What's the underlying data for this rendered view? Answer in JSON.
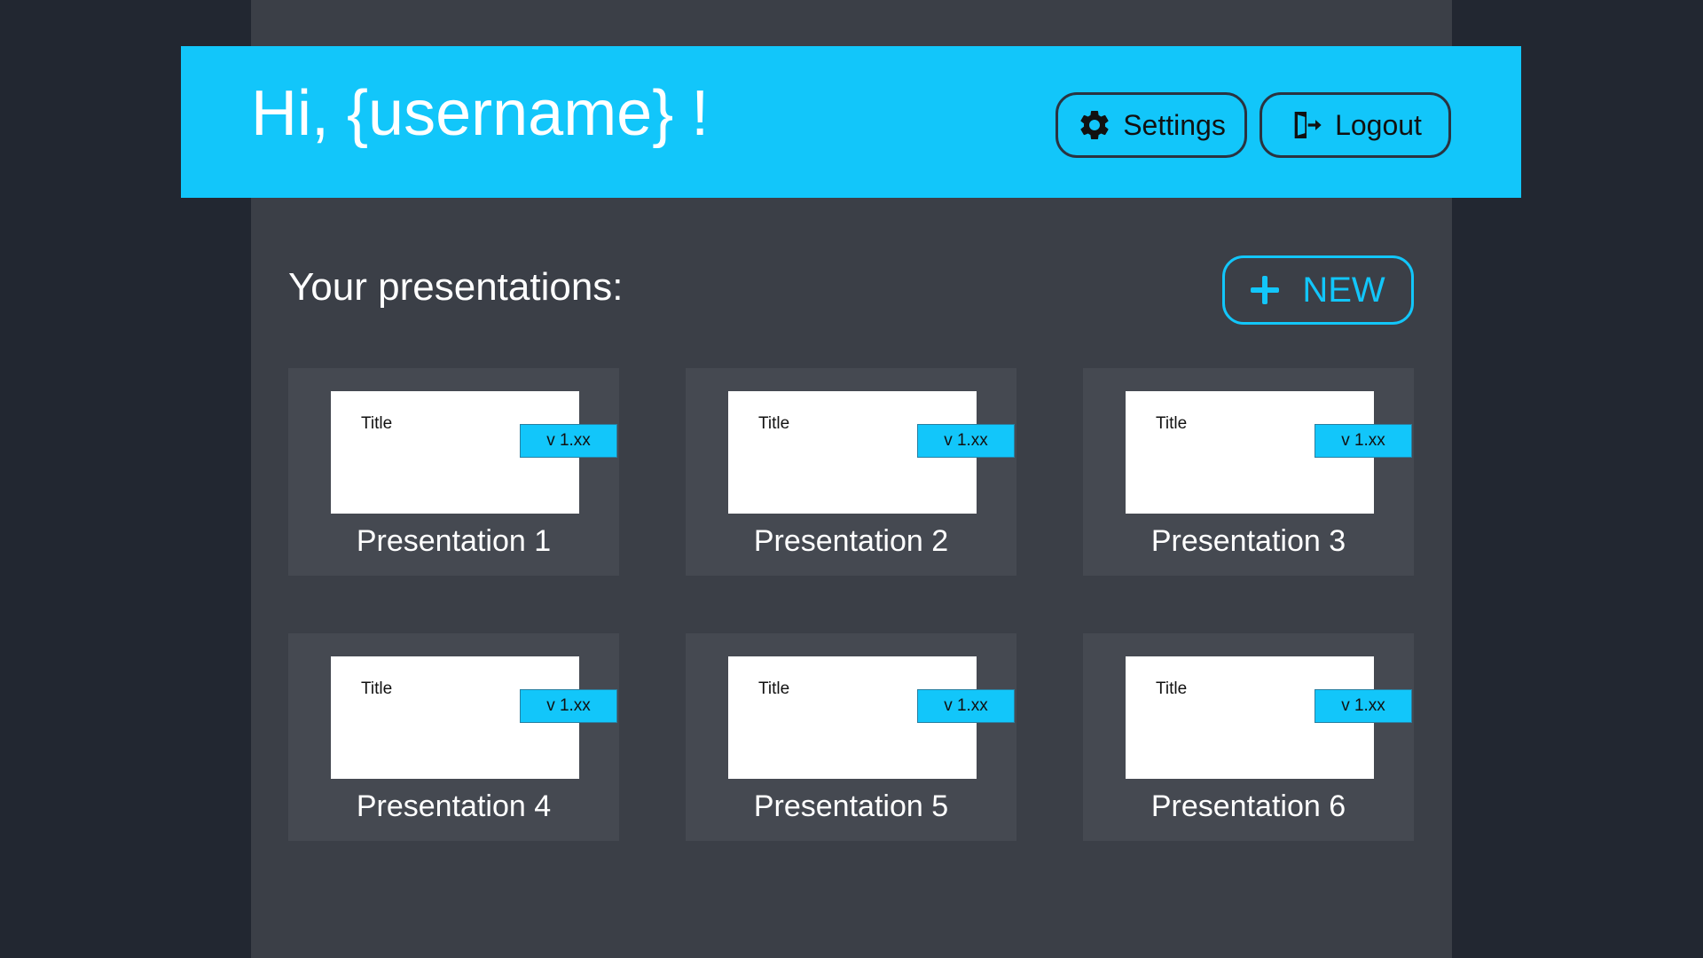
{
  "header": {
    "greeting": "Hi, {username} !",
    "settings_label": "Settings",
    "settings_icon": "gear-icon",
    "logout_label": "Logout",
    "logout_icon": "logout-door-icon"
  },
  "main": {
    "section_title": "Your presentations:",
    "new_button_label": "NEW",
    "new_button_icon": "plus-icon"
  },
  "presentations": [
    {
      "name": "Presentation 1",
      "thumb_title": "Title",
      "version": "v 1.xx"
    },
    {
      "name": "Presentation 2",
      "thumb_title": "Title",
      "version": "v 1.xx"
    },
    {
      "name": "Presentation 3",
      "thumb_title": "Title",
      "version": "v 1.xx"
    },
    {
      "name": "Presentation 4",
      "thumb_title": "Title",
      "version": "v 1.xx"
    },
    {
      "name": "Presentation 5",
      "thumb_title": "Title",
      "version": "v 1.xx"
    },
    {
      "name": "Presentation 6",
      "thumb_title": "Title",
      "version": "v 1.xx"
    }
  ],
  "colors": {
    "accent": "#12c6fa",
    "page_background": "#222731",
    "panel_background": "#3b3f47",
    "card_background": "#454951"
  }
}
